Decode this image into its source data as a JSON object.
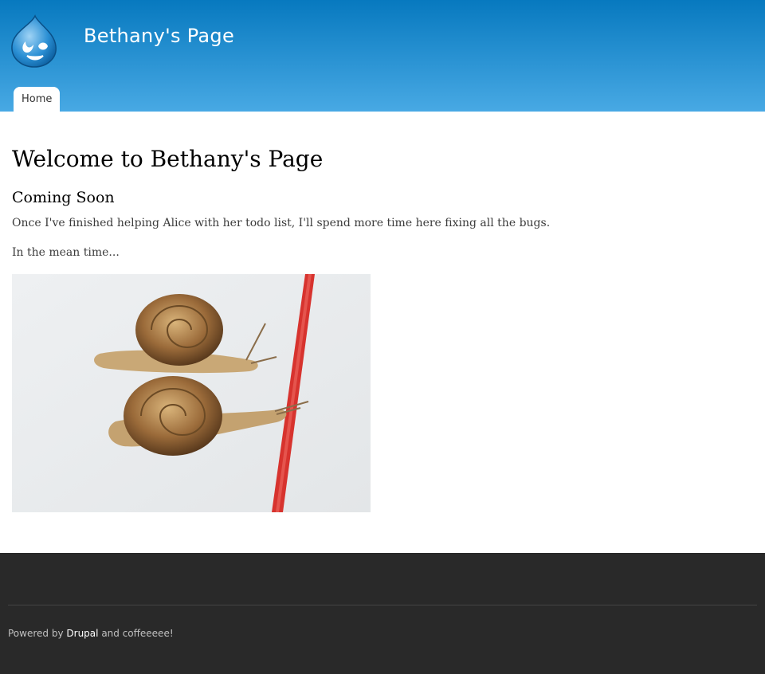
{
  "site": {
    "name": "Bethany's Page",
    "logo_icon": "drupal-drop-icon"
  },
  "nav": {
    "tabs": [
      {
        "label": "Home"
      }
    ]
  },
  "main": {
    "title": "Welcome to Bethany's Page",
    "subtitle": "Coming Soon",
    "paragraph_1": "Once I've finished helping Alice with her todo list, I'll spend more time here fixing all the bugs.",
    "paragraph_2": "In the mean time..."
  },
  "footer": {
    "powered_prefix": "Powered by",
    "drupal_link": "Drupal",
    "powered_suffix": "and coffeeeee!"
  },
  "colors": {
    "header_top": "#0779bf",
    "header_bottom": "#48a9e4",
    "footer_bg": "#292929"
  }
}
